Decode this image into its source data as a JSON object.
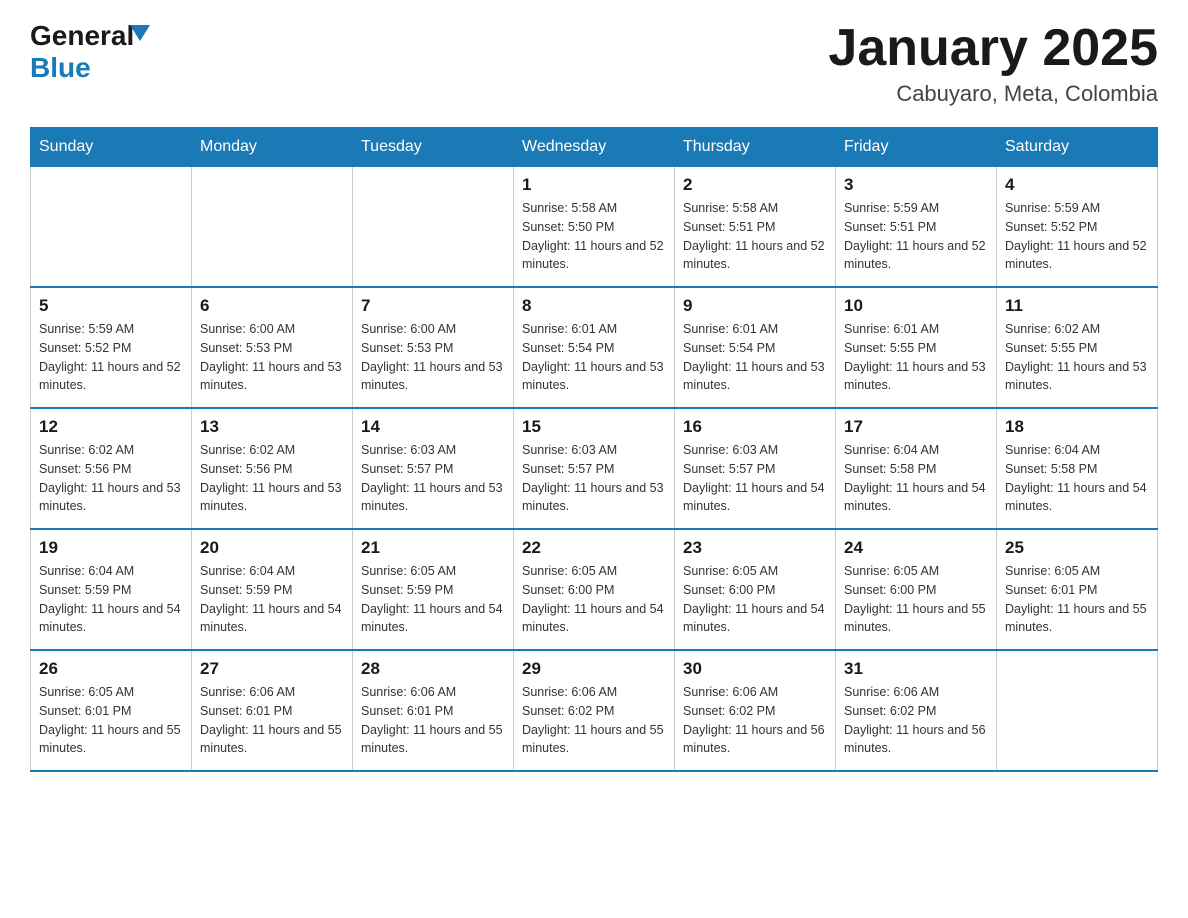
{
  "header": {
    "logo_general": "General",
    "logo_blue": "Blue",
    "month_title": "January 2025",
    "location": "Cabuyaro, Meta, Colombia"
  },
  "days_of_week": [
    "Sunday",
    "Monday",
    "Tuesday",
    "Wednesday",
    "Thursday",
    "Friday",
    "Saturday"
  ],
  "weeks": [
    [
      {
        "day": "",
        "info": ""
      },
      {
        "day": "",
        "info": ""
      },
      {
        "day": "",
        "info": ""
      },
      {
        "day": "1",
        "sunrise": "5:58 AM",
        "sunset": "5:50 PM",
        "daylight": "11 hours and 52 minutes."
      },
      {
        "day": "2",
        "sunrise": "5:58 AM",
        "sunset": "5:51 PM",
        "daylight": "11 hours and 52 minutes."
      },
      {
        "day": "3",
        "sunrise": "5:59 AM",
        "sunset": "5:51 PM",
        "daylight": "11 hours and 52 minutes."
      },
      {
        "day": "4",
        "sunrise": "5:59 AM",
        "sunset": "5:52 PM",
        "daylight": "11 hours and 52 minutes."
      }
    ],
    [
      {
        "day": "5",
        "sunrise": "5:59 AM",
        "sunset": "5:52 PM",
        "daylight": "11 hours and 52 minutes."
      },
      {
        "day": "6",
        "sunrise": "6:00 AM",
        "sunset": "5:53 PM",
        "daylight": "11 hours and 53 minutes."
      },
      {
        "day": "7",
        "sunrise": "6:00 AM",
        "sunset": "5:53 PM",
        "daylight": "11 hours and 53 minutes."
      },
      {
        "day": "8",
        "sunrise": "6:01 AM",
        "sunset": "5:54 PM",
        "daylight": "11 hours and 53 minutes."
      },
      {
        "day": "9",
        "sunrise": "6:01 AM",
        "sunset": "5:54 PM",
        "daylight": "11 hours and 53 minutes."
      },
      {
        "day": "10",
        "sunrise": "6:01 AM",
        "sunset": "5:55 PM",
        "daylight": "11 hours and 53 minutes."
      },
      {
        "day": "11",
        "sunrise": "6:02 AM",
        "sunset": "5:55 PM",
        "daylight": "11 hours and 53 minutes."
      }
    ],
    [
      {
        "day": "12",
        "sunrise": "6:02 AM",
        "sunset": "5:56 PM",
        "daylight": "11 hours and 53 minutes."
      },
      {
        "day": "13",
        "sunrise": "6:02 AM",
        "sunset": "5:56 PM",
        "daylight": "11 hours and 53 minutes."
      },
      {
        "day": "14",
        "sunrise": "6:03 AM",
        "sunset": "5:57 PM",
        "daylight": "11 hours and 53 minutes."
      },
      {
        "day": "15",
        "sunrise": "6:03 AM",
        "sunset": "5:57 PM",
        "daylight": "11 hours and 53 minutes."
      },
      {
        "day": "16",
        "sunrise": "6:03 AM",
        "sunset": "5:57 PM",
        "daylight": "11 hours and 54 minutes."
      },
      {
        "day": "17",
        "sunrise": "6:04 AM",
        "sunset": "5:58 PM",
        "daylight": "11 hours and 54 minutes."
      },
      {
        "day": "18",
        "sunrise": "6:04 AM",
        "sunset": "5:58 PM",
        "daylight": "11 hours and 54 minutes."
      }
    ],
    [
      {
        "day": "19",
        "sunrise": "6:04 AM",
        "sunset": "5:59 PM",
        "daylight": "11 hours and 54 minutes."
      },
      {
        "day": "20",
        "sunrise": "6:04 AM",
        "sunset": "5:59 PM",
        "daylight": "11 hours and 54 minutes."
      },
      {
        "day": "21",
        "sunrise": "6:05 AM",
        "sunset": "5:59 PM",
        "daylight": "11 hours and 54 minutes."
      },
      {
        "day": "22",
        "sunrise": "6:05 AM",
        "sunset": "6:00 PM",
        "daylight": "11 hours and 54 minutes."
      },
      {
        "day": "23",
        "sunrise": "6:05 AM",
        "sunset": "6:00 PM",
        "daylight": "11 hours and 54 minutes."
      },
      {
        "day": "24",
        "sunrise": "6:05 AM",
        "sunset": "6:00 PM",
        "daylight": "11 hours and 55 minutes."
      },
      {
        "day": "25",
        "sunrise": "6:05 AM",
        "sunset": "6:01 PM",
        "daylight": "11 hours and 55 minutes."
      }
    ],
    [
      {
        "day": "26",
        "sunrise": "6:05 AM",
        "sunset": "6:01 PM",
        "daylight": "11 hours and 55 minutes."
      },
      {
        "day": "27",
        "sunrise": "6:06 AM",
        "sunset": "6:01 PM",
        "daylight": "11 hours and 55 minutes."
      },
      {
        "day": "28",
        "sunrise": "6:06 AM",
        "sunset": "6:01 PM",
        "daylight": "11 hours and 55 minutes."
      },
      {
        "day": "29",
        "sunrise": "6:06 AM",
        "sunset": "6:02 PM",
        "daylight": "11 hours and 55 minutes."
      },
      {
        "day": "30",
        "sunrise": "6:06 AM",
        "sunset": "6:02 PM",
        "daylight": "11 hours and 56 minutes."
      },
      {
        "day": "31",
        "sunrise": "6:06 AM",
        "sunset": "6:02 PM",
        "daylight": "11 hours and 56 minutes."
      },
      {
        "day": "",
        "info": ""
      }
    ]
  ]
}
